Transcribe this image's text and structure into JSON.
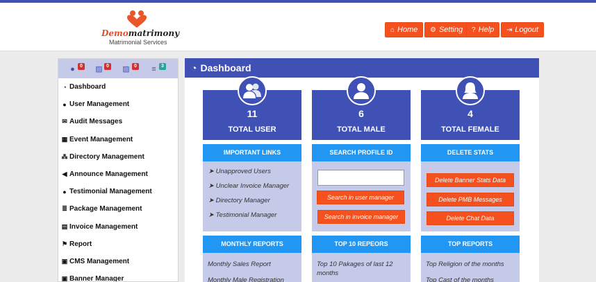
{
  "brand": {
    "name_prefix": "Demo",
    "name_suffix": "matrimony",
    "subtitle": "Matrimonial Services"
  },
  "nav": [
    {
      "label": "Home",
      "icon": "home-icon",
      "glyph": "⌂"
    },
    {
      "label": "Setting",
      "icon": "gear-icon",
      "glyph": "⚙"
    },
    {
      "label": "Help",
      "icon": "help-icon",
      "glyph": "?"
    },
    {
      "label": "Logout",
      "icon": "logout-icon",
      "glyph": "⇥"
    }
  ],
  "sidebar": {
    "badges": [
      "0",
      "0",
      "0",
      "3"
    ],
    "items": [
      {
        "label": "Dashboard",
        "glyph": "◔"
      },
      {
        "label": "User Management",
        "glyph": "●"
      },
      {
        "label": "Audit Messages",
        "glyph": "✉"
      },
      {
        "label": "Event Management",
        "glyph": "▦"
      },
      {
        "label": "Directory Management",
        "glyph": "⁂"
      },
      {
        "label": "Announce Management",
        "glyph": "◀"
      },
      {
        "label": "Testimonial Management",
        "glyph": "●"
      },
      {
        "label": "Package Management",
        "glyph": "≣"
      },
      {
        "label": "Invoice Management",
        "glyph": "▤"
      },
      {
        "label": "Report",
        "glyph": "⚑"
      },
      {
        "label": "CMS Management",
        "glyph": "▣"
      },
      {
        "label": "Banner Manager",
        "glyph": "▣"
      }
    ]
  },
  "main": {
    "title": "Dashboard",
    "stats": [
      {
        "value": "11",
        "label": "TOTAL USER"
      },
      {
        "value": "6",
        "label": "TOTAL MALE"
      },
      {
        "value": "4",
        "label": "TOTAL FEMALE"
      }
    ],
    "important_links": {
      "title": "IMPORTANT LINKS",
      "items": [
        "Unapproved Users",
        "Unclear Invoice Manager",
        "Directory Manager",
        "Testimonial Manager"
      ]
    },
    "search": {
      "title": "SEARCH PROFILE ID",
      "placeholder": "",
      "btn_user": "Search in user manager",
      "btn_invoice": "Search in invoice manager"
    },
    "delete_stats": {
      "title": "DELETE STATS",
      "buttons": [
        "Delete Banner Stats Data",
        "Delete PMB Messages",
        "Delete Chat Data"
      ]
    },
    "monthly": {
      "title": "MONTHLY REPORTS",
      "items": [
        "Monthly Sales Report",
        "Monthly Male Registration"
      ]
    },
    "top10": {
      "title": "TOP 10 REPEORS",
      "items": [
        "Top 10 Pakages of last 12 months"
      ]
    },
    "top": {
      "title": "TOP REPORTS",
      "items": [
        "Top Religion of the months",
        "Top Cast of the months"
      ]
    }
  }
}
